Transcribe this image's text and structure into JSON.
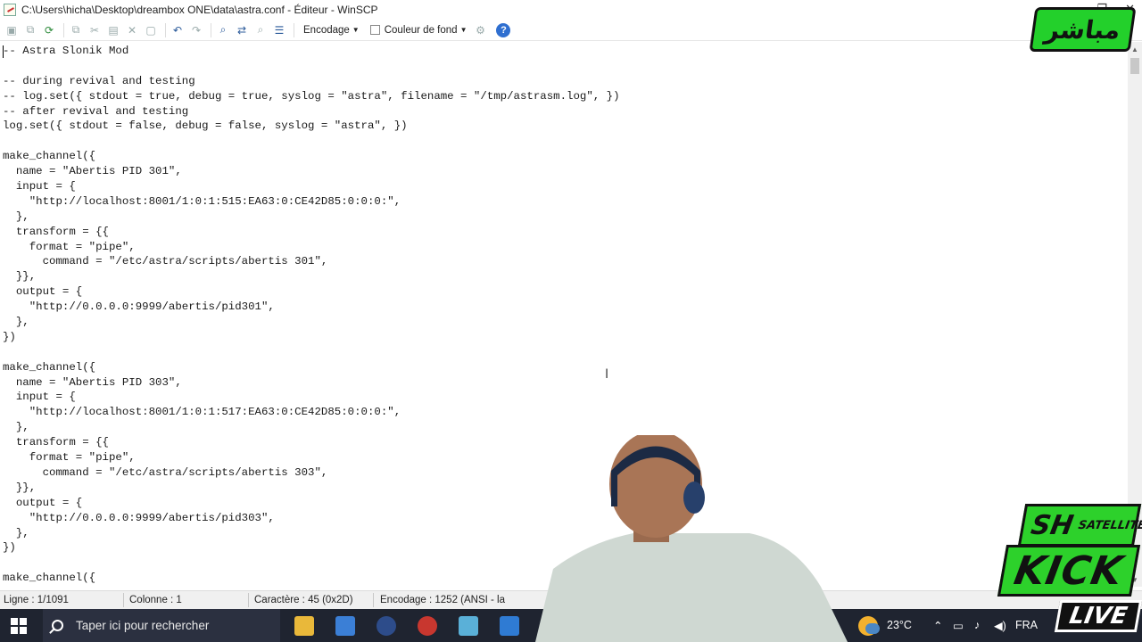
{
  "window": {
    "title": "C:\\Users\\hicha\\Desktop\\dreambox ONE\\data\\astra.conf - Éditeur - WinSCP"
  },
  "toolbar": {
    "encoding_label": "Encodage",
    "background_label": "Couleur de fond"
  },
  "editor": {
    "lines": [
      "-- Astra Slonik Mod",
      "",
      "-- during revival and testing",
      "-- log.set({ stdout = true, debug = true, syslog = \"astra\", filename = \"/tmp/astrasm.log\", })",
      "-- after revival and testing",
      "log.set({ stdout = false, debug = false, syslog = \"astra\", })",
      "",
      "make_channel({",
      "  name = \"Abertis PID 301\",",
      "  input = {",
      "    \"http://localhost:8001/1:0:1:515:EA63:0:CE42D85:0:0:0:\",",
      "  },",
      "  transform = {{",
      "    format = \"pipe\",",
      "      command = \"/etc/astra/scripts/abertis 301\",",
      "  }},",
      "  output = {",
      "    \"http://0.0.0.0:9999/abertis/pid301\",",
      "  },",
      "})",
      "",
      "make_channel({",
      "  name = \"Abertis PID 303\",",
      "  input = {",
      "    \"http://localhost:8001/1:0:1:517:EA63:0:CE42D85:0:0:0:\",",
      "  },",
      "  transform = {{",
      "    format = \"pipe\",",
      "      command = \"/etc/astra/scripts/abertis 303\",",
      "  }},",
      "  output = {",
      "    \"http://0.0.0.0:9999/abertis/pid303\",",
      "  },",
      "})",
      "",
      "make_channel({"
    ]
  },
  "statusbar": {
    "line": "Ligne : 1/1091",
    "column": "Colonne : 1",
    "character": "Caractère : 45 (0x2D)",
    "encoding": "Encodage : 1252  (ANSI - la"
  },
  "taskbar": {
    "search_placeholder": "Taper ici pour rechercher",
    "temperature": "23°C",
    "language": "FRA"
  },
  "overlay": {
    "live_badge": "مباشر",
    "brand_sh": "SH",
    "brand_satellite": "SATELLITE",
    "brand_kick": "KICK",
    "brand_live": "LIVE"
  },
  "colors": {
    "taskbar_bg": "#1f2430",
    "brand_green": "#2dd12b",
    "help_blue": "#2f6fd0"
  }
}
